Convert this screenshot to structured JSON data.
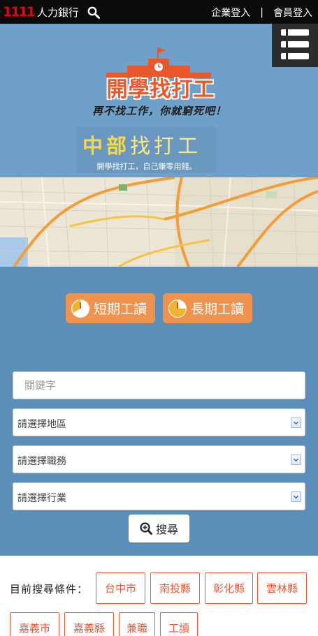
{
  "topbar": {
    "brand_number": "1111",
    "brand_name": "人力銀行",
    "search_icon": "search-icon",
    "links": [
      "企業登入",
      "會員登入"
    ],
    "separator": "|"
  },
  "hero": {
    "logo_title": "開學找打工",
    "slogan": "再不找工作，你就窮死吧！",
    "region_title_strong": "中部",
    "region_title_light": "找打工",
    "region_subtitle": "開學找打工，自己賺零用錢。",
    "menu_icon": "hamburger-menu-icon",
    "colors": {
      "accent": "#e8582a",
      "region": "#f4d94a",
      "hero_bg": "#6fa0c9"
    }
  },
  "job_types": [
    {
      "label": "短期工讀",
      "icon": "clock-icon"
    },
    {
      "label": "長期工讀",
      "icon": "clock-icon"
    }
  ],
  "search": {
    "keyword_placeholder": "關鍵字",
    "region_select": "請選擇地區",
    "job_select": "請選擇職務",
    "industry_select": "請選擇行業",
    "button_label": "搜尋",
    "button_icon": "magnifier-plus-icon"
  },
  "conditions": {
    "label": "目前搜尋條件：",
    "tags": [
      "台中市",
      "南投縣",
      "彰化縣",
      "雲林縣",
      "嘉義市",
      "嘉義縣",
      "兼職",
      "工讀"
    ]
  },
  "colors": {
    "blue_section": "#5b8fb9",
    "button_orange": "#f0934e",
    "tag_red": "#e85a3a"
  }
}
